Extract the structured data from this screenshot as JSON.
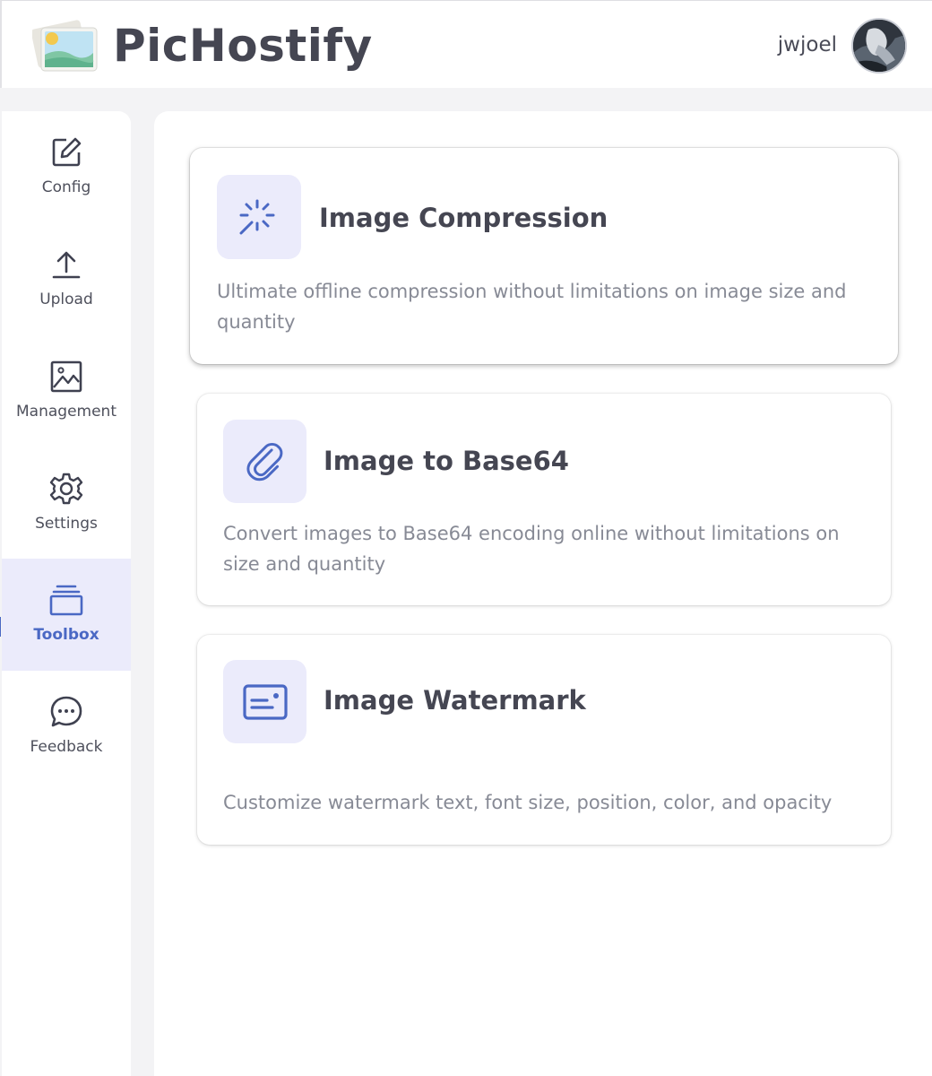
{
  "header": {
    "app_name": "PicHostify",
    "username": "jwjoel",
    "logo_icon": "photos-stack-icon",
    "avatar_icon": "user-avatar"
  },
  "sidebar": {
    "items": [
      {
        "label": "Config",
        "icon": "edit-square-icon",
        "active": false
      },
      {
        "label": "Upload",
        "icon": "upload-arrow-icon",
        "active": false
      },
      {
        "label": "Management",
        "icon": "image-frame-icon",
        "active": false
      },
      {
        "label": "Settings",
        "icon": "gear-icon",
        "active": false
      },
      {
        "label": "Toolbox",
        "icon": "stacked-layers-icon",
        "active": true
      },
      {
        "label": "Feedback",
        "icon": "chat-bubble-icon",
        "active": false
      }
    ]
  },
  "tools": [
    {
      "title": "Image Compression",
      "description": "Ultimate offline compression without limitations on image size and quantity",
      "icon": "magic-wand-icon"
    },
    {
      "title": "Image to Base64",
      "description": "Convert images to Base64 encoding online without limitations on size and quantity",
      "icon": "paperclip-icon"
    },
    {
      "title": "Image Watermark",
      "description": "Customize watermark text, font size, position, color, and opacity",
      "icon": "watermark-card-icon"
    }
  ],
  "colors": {
    "accent": "#4a68c4",
    "active_bg": "#ebebfb",
    "text_primary": "#454652",
    "text_muted": "#878a95",
    "page_bg": "#f3f3f5"
  }
}
